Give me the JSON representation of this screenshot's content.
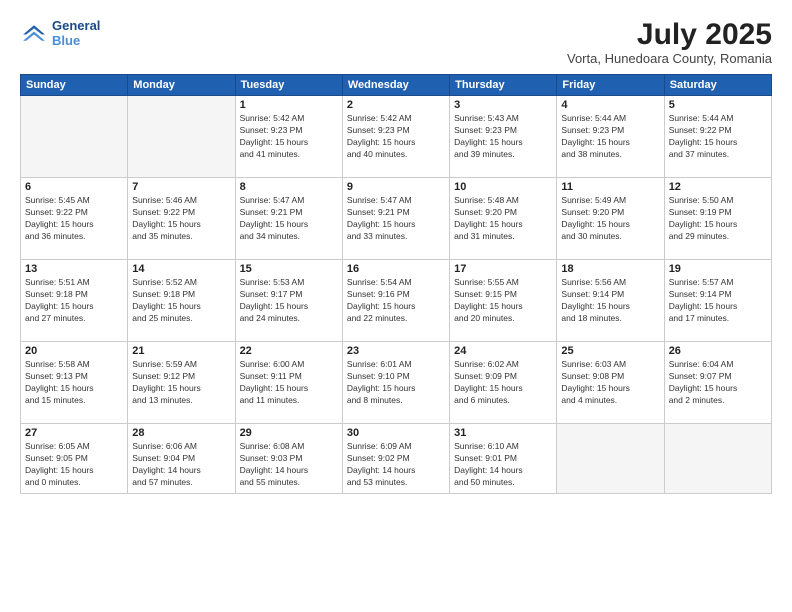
{
  "header": {
    "logo_line1": "General",
    "logo_line2": "Blue",
    "month": "July 2025",
    "location": "Vorta, Hunedoara County, Romania"
  },
  "weekdays": [
    "Sunday",
    "Monday",
    "Tuesday",
    "Wednesday",
    "Thursday",
    "Friday",
    "Saturday"
  ],
  "weeks": [
    [
      {
        "day": "",
        "info": ""
      },
      {
        "day": "",
        "info": ""
      },
      {
        "day": "1",
        "info": "Sunrise: 5:42 AM\nSunset: 9:23 PM\nDaylight: 15 hours\nand 41 minutes."
      },
      {
        "day": "2",
        "info": "Sunrise: 5:42 AM\nSunset: 9:23 PM\nDaylight: 15 hours\nand 40 minutes."
      },
      {
        "day": "3",
        "info": "Sunrise: 5:43 AM\nSunset: 9:23 PM\nDaylight: 15 hours\nand 39 minutes."
      },
      {
        "day": "4",
        "info": "Sunrise: 5:44 AM\nSunset: 9:23 PM\nDaylight: 15 hours\nand 38 minutes."
      },
      {
        "day": "5",
        "info": "Sunrise: 5:44 AM\nSunset: 9:22 PM\nDaylight: 15 hours\nand 37 minutes."
      }
    ],
    [
      {
        "day": "6",
        "info": "Sunrise: 5:45 AM\nSunset: 9:22 PM\nDaylight: 15 hours\nand 36 minutes."
      },
      {
        "day": "7",
        "info": "Sunrise: 5:46 AM\nSunset: 9:22 PM\nDaylight: 15 hours\nand 35 minutes."
      },
      {
        "day": "8",
        "info": "Sunrise: 5:47 AM\nSunset: 9:21 PM\nDaylight: 15 hours\nand 34 minutes."
      },
      {
        "day": "9",
        "info": "Sunrise: 5:47 AM\nSunset: 9:21 PM\nDaylight: 15 hours\nand 33 minutes."
      },
      {
        "day": "10",
        "info": "Sunrise: 5:48 AM\nSunset: 9:20 PM\nDaylight: 15 hours\nand 31 minutes."
      },
      {
        "day": "11",
        "info": "Sunrise: 5:49 AM\nSunset: 9:20 PM\nDaylight: 15 hours\nand 30 minutes."
      },
      {
        "day": "12",
        "info": "Sunrise: 5:50 AM\nSunset: 9:19 PM\nDaylight: 15 hours\nand 29 minutes."
      }
    ],
    [
      {
        "day": "13",
        "info": "Sunrise: 5:51 AM\nSunset: 9:18 PM\nDaylight: 15 hours\nand 27 minutes."
      },
      {
        "day": "14",
        "info": "Sunrise: 5:52 AM\nSunset: 9:18 PM\nDaylight: 15 hours\nand 25 minutes."
      },
      {
        "day": "15",
        "info": "Sunrise: 5:53 AM\nSunset: 9:17 PM\nDaylight: 15 hours\nand 24 minutes."
      },
      {
        "day": "16",
        "info": "Sunrise: 5:54 AM\nSunset: 9:16 PM\nDaylight: 15 hours\nand 22 minutes."
      },
      {
        "day": "17",
        "info": "Sunrise: 5:55 AM\nSunset: 9:15 PM\nDaylight: 15 hours\nand 20 minutes."
      },
      {
        "day": "18",
        "info": "Sunrise: 5:56 AM\nSunset: 9:14 PM\nDaylight: 15 hours\nand 18 minutes."
      },
      {
        "day": "19",
        "info": "Sunrise: 5:57 AM\nSunset: 9:14 PM\nDaylight: 15 hours\nand 17 minutes."
      }
    ],
    [
      {
        "day": "20",
        "info": "Sunrise: 5:58 AM\nSunset: 9:13 PM\nDaylight: 15 hours\nand 15 minutes."
      },
      {
        "day": "21",
        "info": "Sunrise: 5:59 AM\nSunset: 9:12 PM\nDaylight: 15 hours\nand 13 minutes."
      },
      {
        "day": "22",
        "info": "Sunrise: 6:00 AM\nSunset: 9:11 PM\nDaylight: 15 hours\nand 11 minutes."
      },
      {
        "day": "23",
        "info": "Sunrise: 6:01 AM\nSunset: 9:10 PM\nDaylight: 15 hours\nand 8 minutes."
      },
      {
        "day": "24",
        "info": "Sunrise: 6:02 AM\nSunset: 9:09 PM\nDaylight: 15 hours\nand 6 minutes."
      },
      {
        "day": "25",
        "info": "Sunrise: 6:03 AM\nSunset: 9:08 PM\nDaylight: 15 hours\nand 4 minutes."
      },
      {
        "day": "26",
        "info": "Sunrise: 6:04 AM\nSunset: 9:07 PM\nDaylight: 15 hours\nand 2 minutes."
      }
    ],
    [
      {
        "day": "27",
        "info": "Sunrise: 6:05 AM\nSunset: 9:05 PM\nDaylight: 15 hours\nand 0 minutes."
      },
      {
        "day": "28",
        "info": "Sunrise: 6:06 AM\nSunset: 9:04 PM\nDaylight: 14 hours\nand 57 minutes."
      },
      {
        "day": "29",
        "info": "Sunrise: 6:08 AM\nSunset: 9:03 PM\nDaylight: 14 hours\nand 55 minutes."
      },
      {
        "day": "30",
        "info": "Sunrise: 6:09 AM\nSunset: 9:02 PM\nDaylight: 14 hours\nand 53 minutes."
      },
      {
        "day": "31",
        "info": "Sunrise: 6:10 AM\nSunset: 9:01 PM\nDaylight: 14 hours\nand 50 minutes."
      },
      {
        "day": "",
        "info": ""
      },
      {
        "day": "",
        "info": ""
      }
    ]
  ]
}
